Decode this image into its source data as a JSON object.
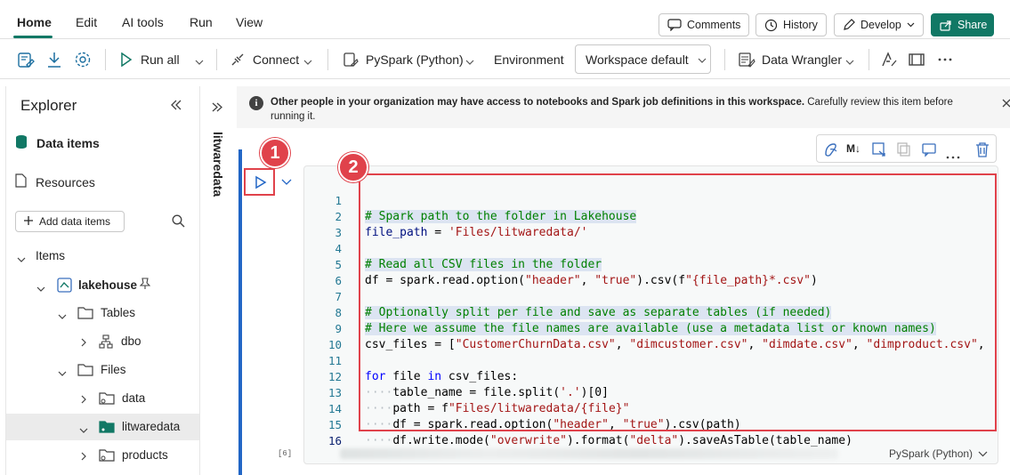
{
  "menu": {
    "items": [
      "Home",
      "Edit",
      "AI tools",
      "Run",
      "View"
    ],
    "active": "Home",
    "comments_label": "Comments",
    "history_label": "History",
    "develop_label": "Develop",
    "share_label": "Share"
  },
  "toolbar": {
    "run_all_label": "Run all",
    "connect_label": "Connect",
    "language_label": "PySpark (Python)",
    "environment_label": "Environment",
    "environment_value": "Workspace default",
    "data_wrangler_label": "Data Wrangler"
  },
  "explorer": {
    "title": "Explorer",
    "data_items_label": "Data items",
    "resources_label": "Resources",
    "add_data_items_label": "Add data items",
    "items_label": "Items",
    "tree": [
      {
        "label": "lakehouse"
      },
      {
        "label": "Tables"
      },
      {
        "label": "dbo"
      },
      {
        "label": "Files"
      },
      {
        "label": "data"
      },
      {
        "label": "litwaredata"
      },
      {
        "label": "products"
      }
    ]
  },
  "notebook": {
    "name": "litwaredata"
  },
  "notice": {
    "bold_text": "Other people in your organization may have access to notebooks and Spark job definitions in this workspace.",
    "text": " Carefully review this item before running it."
  },
  "cell": {
    "execution_count": "[6]",
    "language": "PySpark (Python)",
    "line_numbers": [
      "1",
      "2",
      "3",
      "4",
      "5",
      "6",
      "7",
      "8",
      "9",
      "10",
      "11",
      "12",
      "13",
      "14",
      "15",
      "16"
    ]
  },
  "code_tokens": {
    "l1": "# Spark path to the folder in Lakehouse",
    "l2_var": "file_path",
    "l2_op": " = ",
    "l2_str": "'Files/litwaredata/'",
    "l4": "# Read all CSV files in the folder",
    "l5_a": "df = spark.read.option(",
    "l5_s1": "\"header\"",
    "l5_b": ", ",
    "l5_s2": "\"true\"",
    "l5_c": ").csv(f",
    "l5_s3": "\"{file_path}*.csv\"",
    "l5_d": ")",
    "l7": "# Optionally split per file and save as separate tables (if needed)",
    "l8": "# Here we assume the file names are available (use a metadata list or known names)",
    "l9_a": "csv_files = [",
    "l9_s1": "\"CustomerChurnData.csv\"",
    "l9_s2": "\"dimcustomer.csv\"",
    "l9_s3": "\"dimdate.csv\"",
    "l9_s4": "\"dimproduct.csv\"",
    "l9_sep": ", ",
    "l9_tail": ",",
    "l11_kw1": "for",
    "l11_a": " file ",
    "l11_kw2": "in",
    "l11_b": " csv_files:",
    "l12_a": "table_name = file.split(",
    "l12_s": "'.'",
    "l12_b": ")[0]",
    "l13_a": "path = f",
    "l13_s": "\"Files/litwaredata/{file}\"",
    "l14_a": "df = spark.read.option(",
    "l14_s1": "\"header\"",
    "l14_b": ", ",
    "l14_s2": "\"true\"",
    "l14_c": ").csv(path)",
    "l15_a": "df.write.mode(",
    "l15_s1": "\"overwrite\"",
    "l15_b": ").format(",
    "l15_s2": "\"delta\"",
    "l15_c": ").saveAsTable(table_name)",
    "indent": "····"
  },
  "badges": {
    "one": "1",
    "two": "2"
  },
  "colors": {
    "accent": "#117865",
    "callout_red": "#e0424b",
    "cell_bar_blue": "#2266c6"
  }
}
